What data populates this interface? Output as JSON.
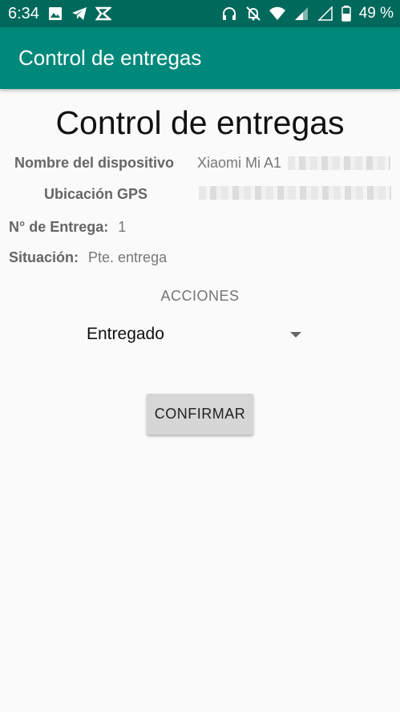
{
  "status_bar": {
    "time": "6:34",
    "battery": "49 %",
    "icons_left": [
      "image-icon",
      "telegram-icon",
      "delivery-app-icon"
    ],
    "icons_right": [
      "headphones-icon",
      "notifications-off-icon",
      "wifi-icon",
      "signal-icon",
      "signal-empty-icon",
      "battery-icon"
    ]
  },
  "app_bar": {
    "title": "Control de entregas"
  },
  "main": {
    "title": "Control de entregas",
    "device_name_label": "Nombre del dispositivo",
    "device_name_value": "Xiaomi Mi A1",
    "gps_label": "Ubicación GPS",
    "delivery_number_label": "N° de Entrega:",
    "delivery_number_value": "1",
    "status_label": "Situación:",
    "status_value": "Pte. entrega",
    "actions_label": "ACCIONES",
    "action_selected": "Entregado",
    "confirm_label": "CONFIRMAR"
  },
  "colors": {
    "status_bar": "#00695c",
    "app_bar": "#00897b",
    "background": "#fafafa",
    "button": "#d6d6d6"
  }
}
